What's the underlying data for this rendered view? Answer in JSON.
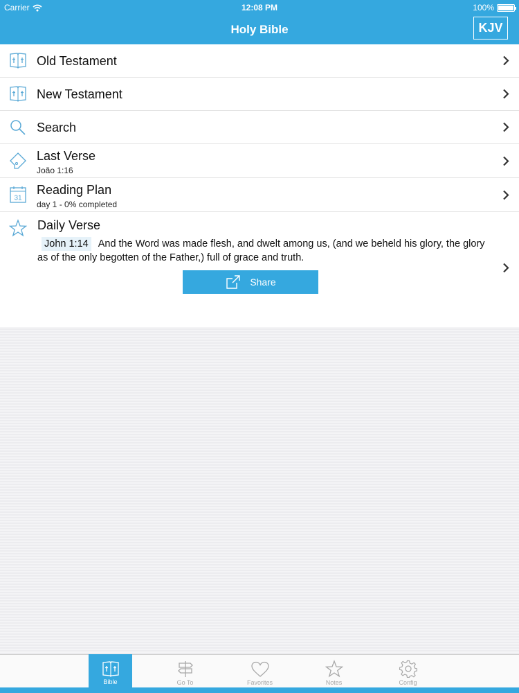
{
  "status_bar": {
    "carrier": "Carrier",
    "time": "12:08 PM",
    "battery": "100%"
  },
  "nav": {
    "title": "Holy Bible",
    "version_button": "KJV"
  },
  "menu": {
    "old_testament": {
      "label": "Old Testament",
      "icon": "bible-book-icon"
    },
    "new_testament": {
      "label": "New Testament",
      "icon": "bible-book-icon"
    },
    "search": {
      "label": "Search",
      "icon": "search-icon"
    },
    "last_verse": {
      "label": "Last Verse",
      "sub": "João 1:16",
      "icon": "bookmark-tag-icon"
    },
    "reading_plan": {
      "label": "Reading Plan",
      "sub": "day 1 - 0% completed",
      "icon": "calendar-icon",
      "calendar_day": "31"
    },
    "daily_verse": {
      "label": "Daily Verse",
      "reference": "John 1:14",
      "text": "And the Word was made flesh, and dwelt among us, (and we beheld his glory, the glory as of the only begotten of the Father,) full of grace and truth.",
      "share_label": "Share",
      "icon": "star-icon"
    }
  },
  "tabs": [
    {
      "label": "Bible",
      "icon": "bible-book-icon",
      "active": true
    },
    {
      "label": "Go To",
      "icon": "signpost-icon",
      "active": false
    },
    {
      "label": "Favorites",
      "icon": "heart-icon",
      "active": false
    },
    {
      "label": "Notes",
      "icon": "star-icon",
      "active": false
    },
    {
      "label": "Config",
      "icon": "gear-icon",
      "active": false
    }
  ],
  "colors": {
    "accent": "#35a8df",
    "icon_stroke": "#5aa9d6",
    "tab_inactive": "#a7a7a7",
    "chevron": "#333333"
  }
}
